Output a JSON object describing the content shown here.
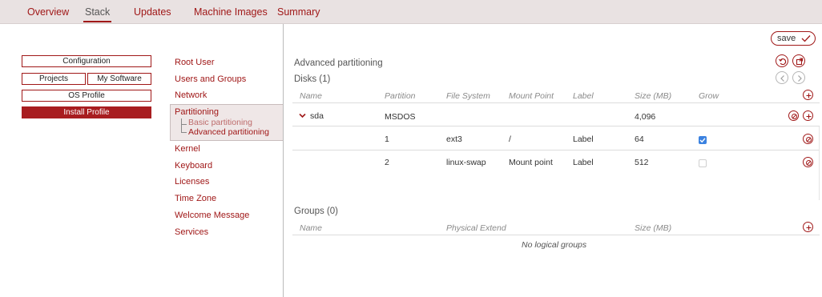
{
  "tabs": [
    "Overview",
    "Stack",
    "Updates",
    "Machine Images",
    "Summary"
  ],
  "profile_buttons": {
    "configuration": "Configuration",
    "projects": "Projects",
    "my_software": "My Software",
    "os_profile": "OS Profile",
    "install_profile": "Install Profile"
  },
  "nav": {
    "root_user": "Root User",
    "users_groups": "Users and Groups",
    "network": "Network",
    "partitioning": "Partitioning",
    "basic_partitioning": "Basic partitioning",
    "advanced_partitioning": "Advanced partitioning",
    "kernel": "Kernel",
    "keyboard": "Keyboard",
    "licenses": "Licenses",
    "time_zone": "Time Zone",
    "welcome_message": "Welcome Message",
    "services": "Services"
  },
  "save_label": "save",
  "main": {
    "title": "Advanced partitioning",
    "disks_title": "Disks (1)",
    "disk_headers": [
      "Name",
      "Partition",
      "File System",
      "Mount Point",
      "Label",
      "Size (MB)",
      "Grow"
    ],
    "disk": {
      "name": "sda",
      "partition": "MSDOS",
      "size": "4,096"
    },
    "partitions": [
      {
        "partition": "1",
        "fs": "ext3",
        "mount": "/",
        "label": "Label",
        "size": "64",
        "grow": true
      },
      {
        "partition": "2",
        "fs": "linux-swap",
        "mount": "Mount point",
        "label": "Label",
        "size": "512",
        "grow": false
      }
    ],
    "groups_title": "Groups (0)",
    "group_headers": [
      "Name",
      "Physical Extend",
      "Size (MB)"
    ],
    "no_groups": "No logical groups"
  },
  "colors": {
    "accent": "#a01818",
    "accent_fill": "#a81d20",
    "checkbox": "#3b82e0"
  }
}
